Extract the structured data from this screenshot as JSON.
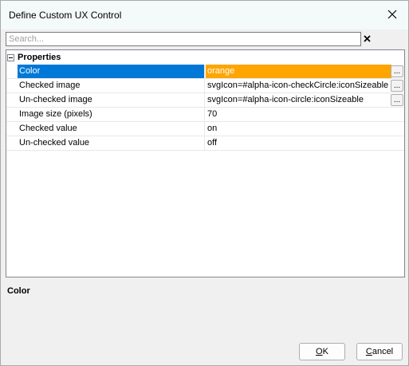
{
  "window": {
    "title": "Define Custom UX Control"
  },
  "search": {
    "placeholder": "Search..."
  },
  "grid": {
    "category": "Properties",
    "rows": [
      {
        "name": "Color",
        "value": "orange",
        "selected": true,
        "has_ellipsis": true
      },
      {
        "name": "Checked image",
        "value": "svgIcon=#alpha-icon-checkCircle:iconSizeable",
        "has_ellipsis": true
      },
      {
        "name": "Un-checked image",
        "value": "svgIcon=#alpha-icon-circle:iconSizeable",
        "has_ellipsis": true
      },
      {
        "name": "Image size (pixels)",
        "value": "70"
      },
      {
        "name": "Checked value",
        "value": "on"
      },
      {
        "name": "Un-checked value",
        "value": "off"
      }
    ],
    "ellipsis_label": "..."
  },
  "help": {
    "title": "Color"
  },
  "buttons": {
    "ok_first": "O",
    "ok_rest": "K",
    "cancel_first": "C",
    "cancel_rest": "ancel"
  },
  "colors": {
    "selection": "#0078d7",
    "orange": "#ffa500"
  }
}
